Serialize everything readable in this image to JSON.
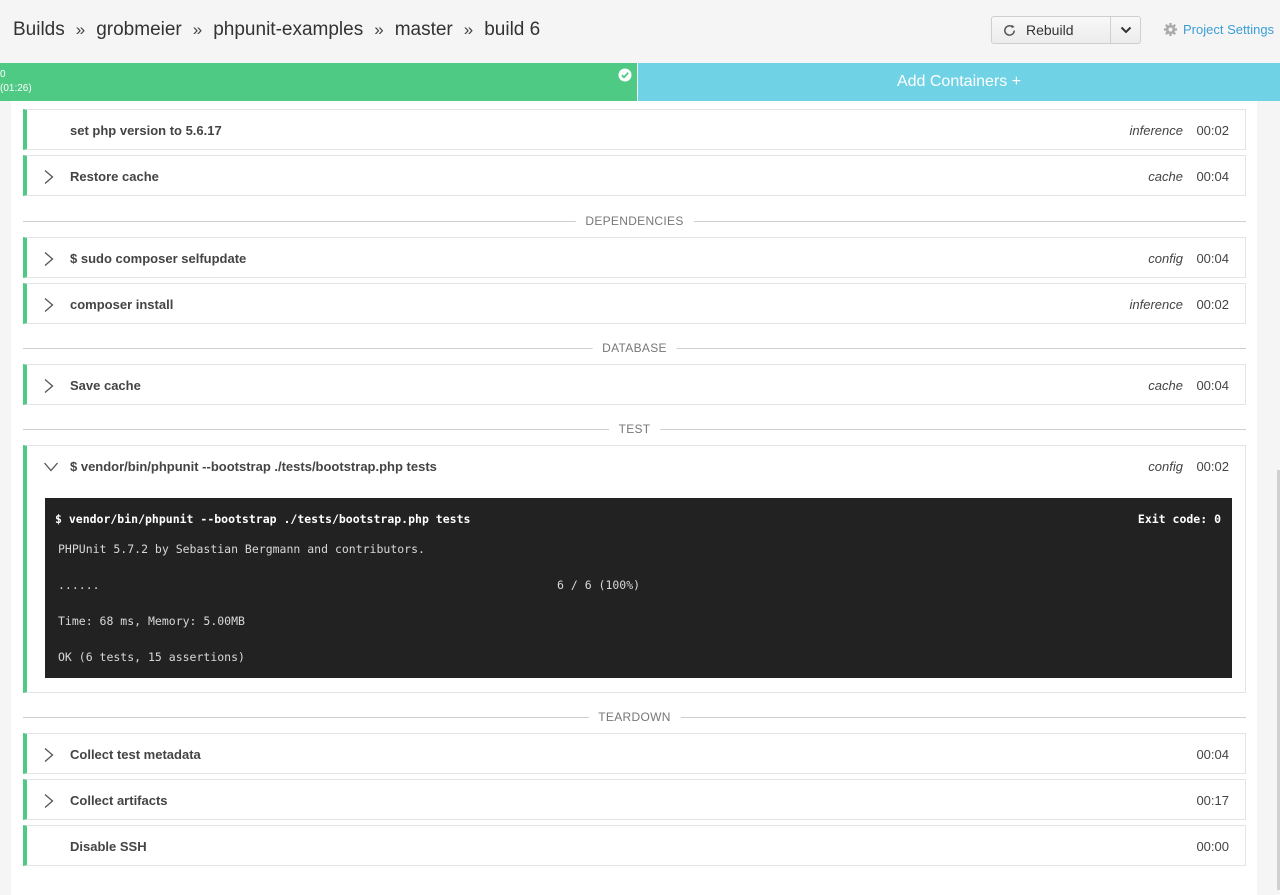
{
  "breadcrumb": {
    "items": [
      "Builds",
      "grobmeier",
      "phpunit-examples",
      "master",
      "build 6"
    ],
    "separator": "»"
  },
  "toolbar": {
    "rebuild_label": "Rebuild",
    "project_settings_label": "Project Settings"
  },
  "containers": {
    "container0_name": "0",
    "container0_time": "(01:26)",
    "add_label": "Add Containers +"
  },
  "colors": {
    "success": "#4fca84",
    "add_containers": "#6fd3e5",
    "link": "#3a9fd6",
    "terminal_bg": "#222222"
  },
  "steps": [
    {
      "name": "set php version to 5.6.17",
      "type": "inference",
      "duration": "00:02",
      "icon": "none"
    },
    {
      "name": "Restore cache",
      "type": "cache",
      "duration": "00:04",
      "icon": "chevron-right-icon"
    },
    {
      "name": "$ sudo composer selfupdate",
      "type": "config",
      "duration": "00:04",
      "icon": "chevron-right-icon"
    },
    {
      "name": "composer install",
      "type": "inference",
      "duration": "00:02",
      "icon": "chevron-right-icon"
    },
    {
      "name": "Save cache",
      "type": "cache",
      "duration": "00:04",
      "icon": "chevron-right-icon"
    },
    {
      "name": "$ vendor/bin/phpunit --bootstrap ./tests/bootstrap.php tests",
      "type": "config",
      "duration": "00:02",
      "icon": "chevron-down-icon"
    },
    {
      "name": "Collect test metadata",
      "type": "",
      "duration": "00:04",
      "icon": "chevron-right-icon"
    },
    {
      "name": "Collect artifacts",
      "type": "",
      "duration": "00:17",
      "icon": "chevron-right-icon"
    },
    {
      "name": "Disable SSH",
      "type": "",
      "duration": "00:00",
      "icon": "none"
    }
  ],
  "sections": [
    "DEPENDENCIES",
    "DATABASE",
    "TEST",
    "TEARDOWN"
  ],
  "terminal": {
    "command": "$ vendor/bin/phpunit --bootstrap ./tests/bootstrap.php tests",
    "exit_code": "Exit code: 0",
    "line1": "PHPUnit 5.7.2 by Sebastian Bergmann and contributors.",
    "dots": "......",
    "progress": "6 / 6 (100%)",
    "line3": "Time: 68 ms, Memory: 5.00MB",
    "line4": "OK (6 tests, 15 assertions)"
  }
}
